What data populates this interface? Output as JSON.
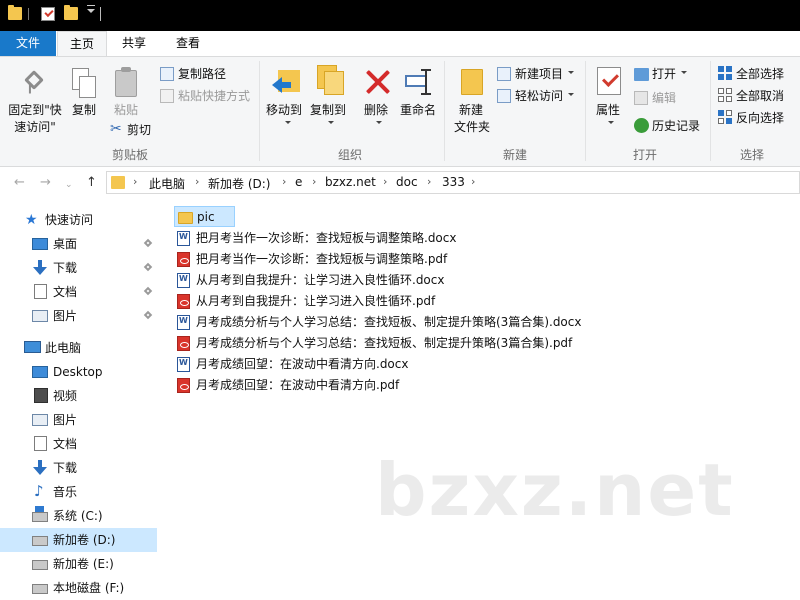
{
  "ribbon_tabs": [
    "文件",
    "主页",
    "共享",
    "查看"
  ],
  "ribbon": {
    "clipboard": {
      "pin_label_line1": "固定到\"快",
      "pin_label_line2": "速访问\"",
      "copy": "复制",
      "paste": "粘贴",
      "copy_path": "复制路径",
      "paste_shortcut": "粘贴快捷方式",
      "cut": "剪切",
      "group": "剪贴板"
    },
    "organize": {
      "move_to": "移动到",
      "copy_to": "复制到",
      "delete": "删除",
      "rename": "重命名",
      "group": "组织"
    },
    "new": {
      "new_folder_line1": "新建",
      "new_folder_line2": "文件夹",
      "new_item": "新建项目",
      "easy_access": "轻松访问",
      "group": "新建"
    },
    "open": {
      "properties": "属性",
      "open": "打开",
      "edit": "编辑",
      "history": "历史记录",
      "group": "打开"
    },
    "select": {
      "select_all": "全部选择",
      "select_none": "全部取消",
      "invert": "反向选择",
      "group": "选择"
    }
  },
  "address": {
    "crumbs": [
      "此电脑",
      "新加卷 (D:)",
      "e",
      "bzxz.net",
      "doc",
      "333"
    ]
  },
  "nav": {
    "quick_access": "快速访问",
    "quick_items": [
      "桌面",
      "下载",
      "文档",
      "图片"
    ],
    "this_pc": "此电脑",
    "pc_items": [
      "Desktop",
      "视频",
      "图片",
      "文档",
      "下载",
      "音乐"
    ],
    "drives": [
      "系统 (C:)",
      "新加卷 (D:)",
      "新加卷 (E:)",
      "本地磁盘 (F:)"
    ]
  },
  "files": [
    {
      "name": "pic",
      "type": "folder"
    },
    {
      "name": "把月考当作一次诊断：查找短板与调整策略.docx",
      "type": "docx"
    },
    {
      "name": "把月考当作一次诊断：查找短板与调整策略.pdf",
      "type": "pdf"
    },
    {
      "name": "从月考到自我提升：让学习进入良性循环.docx",
      "type": "docx"
    },
    {
      "name": "从月考到自我提升：让学习进入良性循环.pdf",
      "type": "pdf"
    },
    {
      "name": "月考成绩分析与个人学习总结：查找短板、制定提升策略(3篇合集).docx",
      "type": "docx"
    },
    {
      "name": "月考成绩分析与个人学习总结：查找短板、制定提升策略(3篇合集).pdf",
      "type": "pdf"
    },
    {
      "name": "月考成绩回望：在波动中看清方向.docx",
      "type": "docx"
    },
    {
      "name": "月考成绩回望：在波动中看清方向.pdf",
      "type": "pdf"
    }
  ],
  "watermark": "bzxz.net",
  "colors": {
    "file_tab": "#1979ca",
    "selection": "#cce8ff",
    "folder": "#f4c64f",
    "delete": "#d42b2b"
  }
}
